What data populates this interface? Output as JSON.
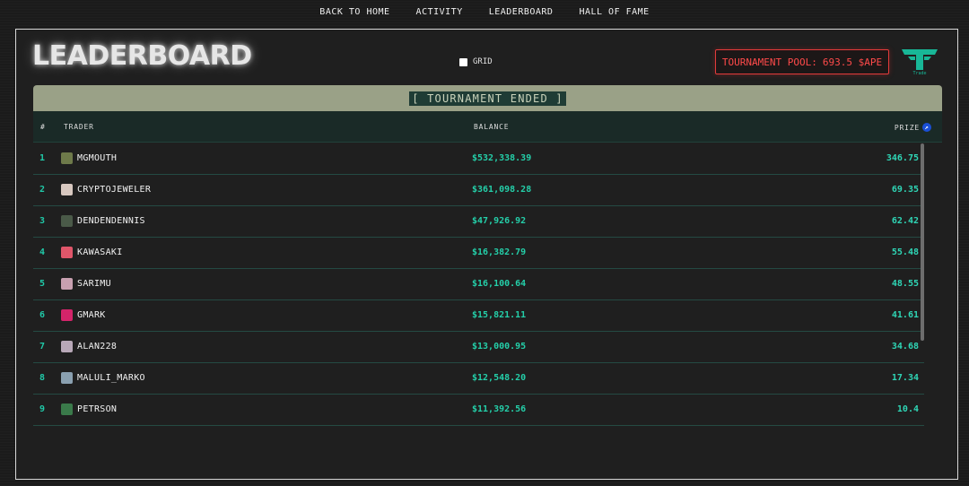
{
  "nav": {
    "items": [
      "BACK TO HOME",
      "ACTIVITY",
      "LEADERBOARD",
      "HALL OF FAME"
    ]
  },
  "header": {
    "title": "LEADERBOARD",
    "grid_label": "GRID",
    "pool_label": "TOURNAMENT POOL:",
    "pool_value": "693.5 $APE",
    "logo_caption": "Trade",
    "pool_color": "#e33b3b",
    "accent_color": "#20c9a8"
  },
  "banner": {
    "text": "[ TOURNAMENT ENDED ]"
  },
  "table": {
    "columns": {
      "rank": "#",
      "trader": "TRADER",
      "balance": "BALANCE",
      "prize": "PRIZE"
    },
    "prize_icon": "ape-coin-icon",
    "rows": [
      {
        "rank": "1",
        "trader": "MGMOUTH",
        "balance": "$532,338.39",
        "prize": "346.75",
        "avatar_color": "#6e7a4a"
      },
      {
        "rank": "2",
        "trader": "CRYPTOJEWELER",
        "balance": "$361,098.28",
        "prize": "69.35",
        "avatar_color": "#d8c8c0"
      },
      {
        "rank": "3",
        "trader": "DENDENDENNIS",
        "balance": "$47,926.92",
        "prize": "62.42",
        "avatar_color": "#4a5a48"
      },
      {
        "rank": "4",
        "trader": "KAWASAKI",
        "balance": "$16,382.79",
        "prize": "55.48",
        "avatar_color": "#e0566a"
      },
      {
        "rank": "5",
        "trader": "SARIMU",
        "balance": "$16,100.64",
        "prize": "48.55",
        "avatar_color": "#c8a0b0"
      },
      {
        "rank": "6",
        "trader": "GMARK",
        "balance": "$15,821.11",
        "prize": "41.61",
        "avatar_color": "#d4246a"
      },
      {
        "rank": "7",
        "trader": "ALAN228",
        "balance": "$13,000.95",
        "prize": "34.68",
        "avatar_color": "#b8a8b8"
      },
      {
        "rank": "8",
        "trader": "MALULI_MARKO",
        "balance": "$12,548.20",
        "prize": "17.34",
        "avatar_color": "#8aa0b0"
      },
      {
        "rank": "9",
        "trader": "PETRSON",
        "balance": "$11,392.56",
        "prize": "10.4",
        "avatar_color": "#3a7a4a"
      }
    ]
  }
}
